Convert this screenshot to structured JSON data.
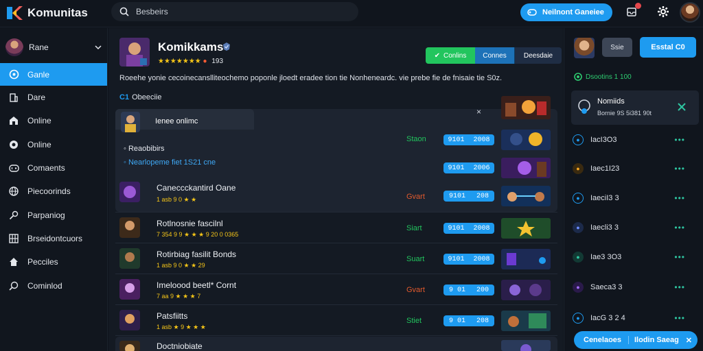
{
  "app": {
    "title": "Komunitas"
  },
  "search": {
    "placeholder": "Besbeirs"
  },
  "topbar": {
    "primary_button": "Neilnont Ganeiee"
  },
  "sidebar": {
    "user_name": "Rane",
    "items": [
      {
        "label": "Ganle",
        "icon": "chat-icon",
        "active": true
      },
      {
        "label": "Dare",
        "icon": "building-icon"
      },
      {
        "label": "Online",
        "icon": "home-icon"
      },
      {
        "label": "Online",
        "icon": "target-icon"
      },
      {
        "label": "Comaents",
        "icon": "gamepad-icon"
      },
      {
        "label": "Piecoorinds",
        "icon": "globe-icon"
      },
      {
        "label": "Parpaniog",
        "icon": "key-icon"
      },
      {
        "label": "Brseidontcuors",
        "icon": "grid-icon"
      },
      {
        "label": "Pecciles",
        "icon": "house-icon"
      },
      {
        "label": "Cominlod",
        "icon": "search-icon"
      }
    ]
  },
  "main": {
    "game_title": "Komikkams",
    "rating_count": "193",
    "tabs": [
      {
        "label": "Conlins",
        "color": "#22c55e"
      },
      {
        "label": "Connes",
        "color": "#1d72b8"
      },
      {
        "label": "Deesdaie",
        "color": "#1f2d44"
      }
    ],
    "description": "Roeehe yonie cecoinecanslliteochemo poponle jloedt eradee tion tie Nonheneardc. vie prebe fie de fnisaie tie S0z.",
    "section_label": "Obeeciie",
    "section_prefix": "C1",
    "top_item": {
      "title": "Ienee onlimc",
      "mark": "×"
    },
    "links": [
      {
        "text": "Reaobibirs",
        "style": "white"
      },
      {
        "text": "Nearlopeme fiet 1S21 cne",
        "style": "blue"
      }
    ],
    "rows": [
      {
        "title": "",
        "stat": "Staon",
        "stat_color": "#22c55e",
        "chip": [
          "9101",
          "2008"
        ],
        "sub": ""
      },
      {
        "title": "",
        "stat": "",
        "stat_color": "#22c55e",
        "chip": [
          "9101",
          "2006"
        ],
        "sub": ""
      },
      {
        "title": "Caneccckantird Oane",
        "stat": "Gvart",
        "stat_color": "#e35a2d",
        "chip": [
          "9101",
          "208"
        ],
        "sub": "1 asb 9 0 ★ ★"
      },
      {
        "title": "Rotlnosnie fascilnl",
        "stat": "Siart",
        "stat_color": "#22c55e",
        "chip": [
          "9101",
          "2008"
        ],
        "sub": "7 354 9 9 ★ ★ ★ 9 20 0 0365"
      },
      {
        "title": "Rotirbiag fasilit Bonds",
        "stat": "Suart",
        "stat_color": "#22c55e",
        "chip": [
          "9101",
          "2008"
        ],
        "sub": "1 asb 9 0 ★ ★ 29"
      },
      {
        "title": "Imeloood beetl* Cornt",
        "stat": "Gvart",
        "stat_color": "#e35a2d",
        "chip": [
          "9 01",
          "200"
        ],
        "sub": "7 aa 9 ★ ★ ★ 7"
      },
      {
        "title": "Patsfiitts",
        "stat": "Stiet",
        "stat_color": "#22c55e",
        "chip": [
          "9 01",
          "208"
        ],
        "sub": "1 asb ★ 9 ★ ★ ★"
      },
      {
        "title": "Doctniobiate",
        "stat": "",
        "stat_color": "#22c55e",
        "chip": [],
        "sub": ""
      }
    ]
  },
  "right": {
    "btn_gray": "Ssie",
    "btn_blue": "Esstal C0",
    "online_label": "Dsootins 1 100",
    "card_title": "Nomiids",
    "card_sub": "Bornie 9S 5i381 90t",
    "rows": [
      {
        "label": "IacI3O3",
        "icon_color": "#1e9bf0"
      },
      {
        "label": "Iaec1I23",
        "icon_color": "#f5a623"
      },
      {
        "label": "IaeciI3 3",
        "icon_color": "#1e9bf0"
      },
      {
        "label": "Iaecli3 3",
        "icon_color": "#6c8cff"
      },
      {
        "label": "Iae3 3O3",
        "icon_color": "#2ec4a0"
      },
      {
        "label": "Saeca3 3",
        "icon_color": "#a46cff"
      },
      {
        "label": "IacG 3 2 4",
        "icon_color": "#1e9bf0"
      }
    ],
    "more_icon": "•••",
    "chat_left": "Cenelaoes",
    "chat_right": "Ilodin Saeag"
  }
}
